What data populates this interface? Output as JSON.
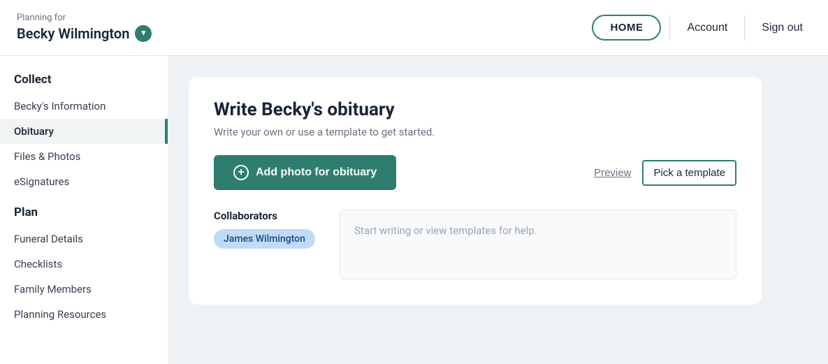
{
  "header": {
    "planning_label": "Planning for",
    "person_name": "Becky Wilmington",
    "home_label": "HOME",
    "account_label": "Account",
    "signout_label": "Sign out"
  },
  "sidebar": {
    "collect_label": "Collect",
    "items_collect": [
      {
        "id": "beckys-information",
        "label": "Becky's Information",
        "active": false
      },
      {
        "id": "obituary",
        "label": "Obituary",
        "active": true
      },
      {
        "id": "files-photos",
        "label": "Files & Photos",
        "active": false
      },
      {
        "id": "esignatures",
        "label": "eSignatures",
        "active": false
      }
    ],
    "plan_label": "Plan",
    "items_plan": [
      {
        "id": "funeral-details",
        "label": "Funeral Details",
        "active": false
      },
      {
        "id": "checklists",
        "label": "Checklists",
        "active": false
      },
      {
        "id": "family-members",
        "label": "Family Members",
        "active": false
      },
      {
        "id": "planning-resources",
        "label": "Planning Resources",
        "active": false
      }
    ]
  },
  "main": {
    "card_title": "Write Becky's obituary",
    "card_subtitle": "Write your own or use a template to get started.",
    "add_photo_label": "Add photo for obituary",
    "preview_label": "Preview",
    "pick_template_label": "Pick a template",
    "collaborators_label": "Collaborators",
    "collaborator_name": "James Wilmington",
    "text_placeholder": "Start writing or view templates for help."
  }
}
